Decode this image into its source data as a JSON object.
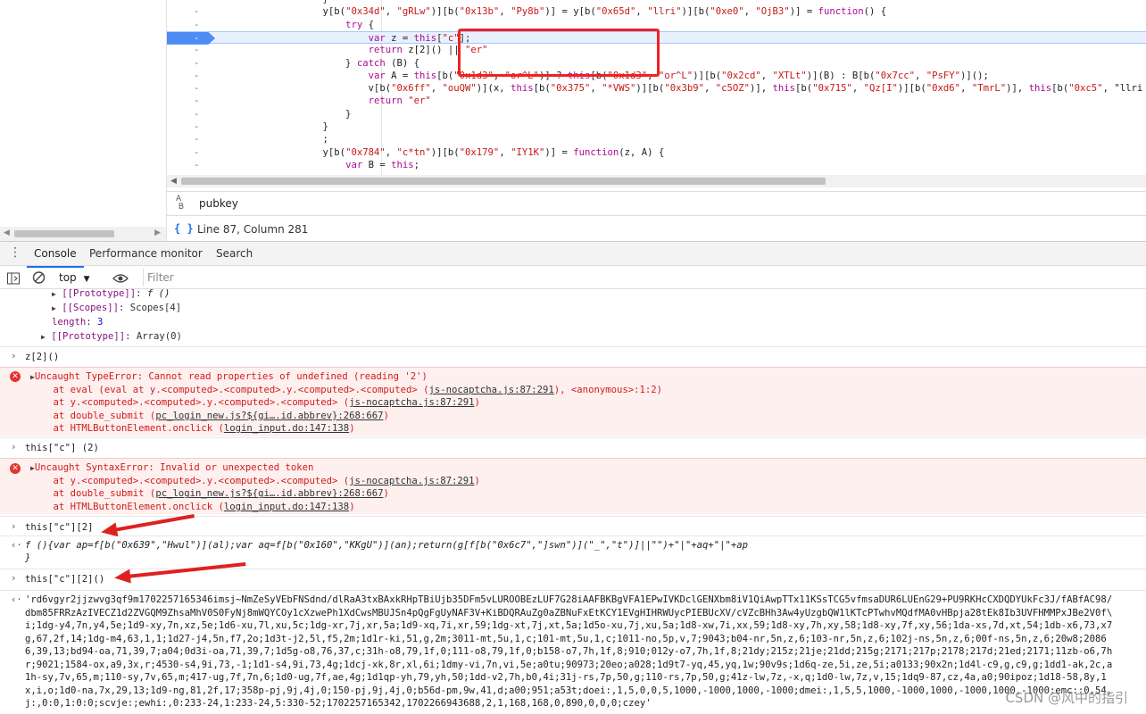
{
  "editor": {
    "lines": [
      {
        "marker": "-",
        "text": "            }"
      },
      {
        "marker": "-",
        "text": "            y[b(\"0x34d\", \"gRLw\")][b(\"0x13b\", \"Py8b\")] = y[b(\"0x65d\", \"llri\")][b(\"0xe0\", \"OjB3\")] = function() {"
      },
      {
        "marker": "-",
        "text": "                try {"
      },
      {
        "marker": "-",
        "text": "                    var z = this[\"c\"];",
        "active": true
      },
      {
        "marker": "-",
        "text": "                    return z[2]() || \"er\""
      },
      {
        "marker": "-",
        "text": "                } catch (B) {"
      },
      {
        "marker": "-",
        "text": "                    var A = this[b(\"0x1d3\", \"or^L\")] ? this[b(\"0x1d3\", \"or^L\")][b(\"0x2cd\", \"XTLt\")](B) : B[b(\"0x7cc\", \"PsFY\")]();"
      },
      {
        "marker": "-",
        "text": "                    v[b(\"0x6ff\", \"ouQW\")](x, this[b(\"0x375\", \"*VWS\")][b(\"0x3b9\", \"c5OZ\")], this[b(\"0x715\", \"Qz[I\")][b(\"0xd6\", \"TmrL\")], this[b(\"0xc5\", \"llri"
      },
      {
        "marker": "-",
        "text": "                    return \"er\""
      },
      {
        "marker": "-",
        "text": "                }"
      },
      {
        "marker": "-",
        "text": "            }"
      },
      {
        "marker": "-",
        "text": "            ;"
      },
      {
        "marker": "-",
        "text": "            y[b(\"0x784\", \"c*tn\")][b(\"0x179\", \"IY1K\")] = function(z, A) {"
      },
      {
        "marker": "-",
        "text": "                var B = this;"
      }
    ]
  },
  "search": {
    "query": "pubkey",
    "ab_icon": "Aa-B"
  },
  "status": {
    "braces_icon": "{ }",
    "position": "Line 87, Column 281"
  },
  "drawer": {
    "tabs": [
      {
        "label": "Console",
        "selected": true
      },
      {
        "label": "Performance monitor",
        "selected": false
      },
      {
        "label": "Search",
        "selected": false
      }
    ]
  },
  "console_toolbar": {
    "context": "top",
    "filter_placeholder": "Filter"
  },
  "console": {
    "tree": [
      {
        "key": "[[Prototype]]",
        "value": "f ()"
      },
      {
        "key": "[[Scopes]]",
        "value": "Scopes[4]"
      },
      {
        "key": "length",
        "value": "3"
      },
      {
        "key": "[[Prototype]]",
        "value": "Array(0)"
      }
    ],
    "cmd1": "z[2]()",
    "err1": {
      "title": "Uncaught TypeError: Cannot read properties of undefined (reading '2')",
      "stack": [
        {
          "pre": "    at eval (eval at y.<computed>.<computed>.y.<computed>.<computed> (",
          "link": "js-nocaptcha.js:87:291",
          "post": "), <anonymous>:1:2)"
        },
        {
          "pre": "    at y.<computed>.<computed>.y.<computed>.<computed> (",
          "link": "js-nocaptcha.js:87:291",
          "post": ")"
        },
        {
          "pre": "    at double_submit (",
          "link": "pc_login_new.js?${gi….id.abbrev}:268:667",
          "post": ")"
        },
        {
          "pre": "    at HTMLButtonElement.onclick (",
          "link": "login_input.do:147:138",
          "post": ")"
        }
      ]
    },
    "cmd2": "this[\"c\"] (2)",
    "err2": {
      "title": "Uncaught SyntaxError: Invalid or unexpected token",
      "stack": [
        {
          "pre": "    at y.<computed>.<computed>.y.<computed>.<computed> (",
          "link": "js-nocaptcha.js:87:291",
          "post": ")"
        },
        {
          "pre": "    at double_submit (",
          "link": "pc_login_new.js?${gi….id.abbrev}:268:667",
          "post": ")"
        },
        {
          "pre": "    at HTMLButtonElement.onclick (",
          "link": "login_input.do:147:138",
          "post": ")"
        }
      ]
    },
    "cmd3": "this[\"c\"][2]",
    "result3": [
      "f (){var ap=f[b(\"0x639\",\"Hwul\")](al);var aq=f[b(\"0x160\",\"KKgU\")](an);return(g[f[b(\"0x6c7\",\"]swn\")](\"_\",\"t\")]||\"\")+\"|\"+aq+\"|\"+ap",
      "}"
    ],
    "cmd4": "this[\"c\"][2]()",
    "result4": [
      "'rd6vgyr2jjzwvg3qf9m1702257165346imsj~NmZeSyVEbFNSdnd/dlRaA3txBAxkRHpTBiUjb35DFm5vLUROOBEzLUF7G28iAAFBKBgVFA1EPwIVKDclGENXbm8iV1QiAwpTTx11KSsTCG5vfmsaDUR6LUEnG29+PU9RKHcCXDQDYUkFc3J/fABfAC98/",
      "dbm85FRRzAzIVECZ1d2ZVGQM9ZhsaMhV0S0FyNj8mWQYCOy1cXzwePh1XdCwsMBUJSn4pQgFgUyNAF3V+KiBDQRAuZg0aZBNuFxEtKCY1EVgHIHRWUycPIEBUcXV/cVZcBHh3Aw4yUzgbQW1lKTcPTwhvMQdfMA0vHBpja28tEk8Ib3UVFHMMPxJBe2V0f\\",
      "i;1dg-y4,7n,y4,5e;1d9-xy,7n,xz,5e;1d6-xu,7l,xu,5c;1dg-xr,7j,xr,5a;1d9-xq,7i,xr,59;1dg-xt,7j,xt,5a;1d5o-xu,7j,xu,5a;1d8-xw,7i,xx,59;1d8-xy,7h,xy,58;1d8-xy,7f,xy,56;1da-xs,7d,xt,54;1db-x6,73,x7",
      "g,67,2f,14;1dg-m4,63,1,1;1d27-j4,5n,f7,2o;1d3t-j2,5l,f5,2m;1d1r-ki,51,g,2m;3011-mt,5u,1,c;101-mt,5u,1,c;1011-no,5p,v,7;9043;b04-nr,5n,z,6;103-nr,5n,z,6;102j-ns,5n,z,6;00f-ns,5n,z,6;20w8;2086",
      "6,39,13;bd94-oa,71,39,7;a04;0d3i-oa,71,39,7;1d5g-o8,76,37,c;31h-o8,79,1f,0;111-o8,79,1f,0;b158-o7,7h,1f,8;910;012y-o7,7h,1f,8;21dy;215z;21je;21dd;215g;2171;217p;2178;217d;21ed;2171;11zb-o6,7h",
      "r;9021;1584-ox,a9,3x,r;4530-s4,9i,73,-1;1d1-s4,9i,73,4g;1dcj-xk,8r,xl,6i;1dmy-vi,7n,vi,5e;a0tu;90973;20eo;a028;1d9t7-yq,45,yq,1w;90v9s;1d6q-ze,5i,ze,5i;a0133;90x2n;1d4l-c9,g,c9,g;1dd1-ak,2c,a",
      "1h-sy,7v,65,m;110-sy,7v,65,m;417-ug,7f,7n,6;1d0-ug,7f,ae,4g;1d1qp-yh,79,yh,50;1dd-v2,7h,b0,4i;31j-rs,7p,50,g;110-rs,7p,50,g;41z-lw,7z,-x,q;1d0-lw,7z,v,15;1dq9-87,cz,4a,a0;90ipoz;1d18-58,8y,1",
      "x,i,o;1d0-na,7x,29,13;1d9-ng,81,2f,17;358p-pj,9j,4j,0;150-pj,9j,4j,0;b56d-pm,9w,41,d;a00;951;a53t;doei:,1,5,0,0,5,1000,-1000,1000,-1000;dmei:,1,5,5,1000,-1000,1000,-1000,1000,-1000;emc::0,54,",
      "j:,0:0,1:0:0;scvje:;ewhi:,0:233-24,1:233-24,5:330-52;1702257165342,1702266943688,2,1,168,168,0,890,0,0,0;czey'"
    ]
  },
  "watermark": "CSDN @风中的指引"
}
